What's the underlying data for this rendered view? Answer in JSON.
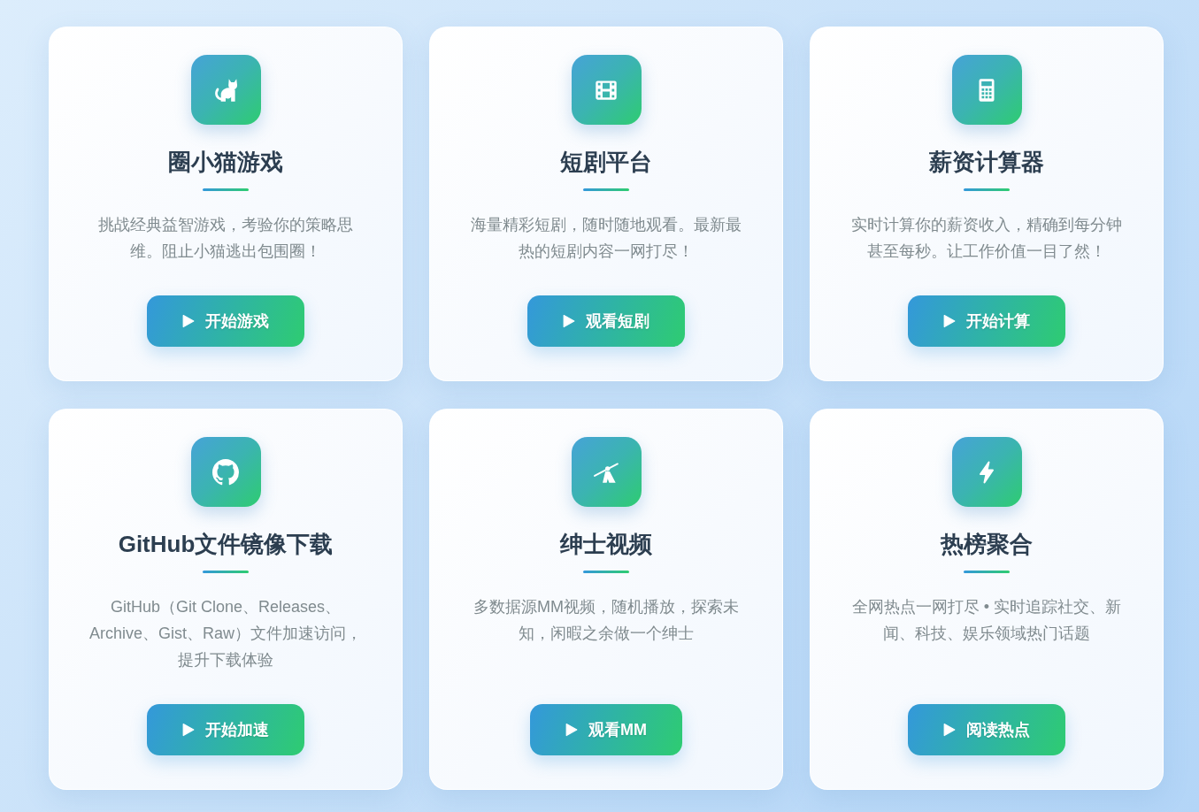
{
  "cards": [
    {
      "kind": "game",
      "title": "圈小猫游戏",
      "description": "挑战经典益智游戏，考验你的策略思维。阻止小猫逃出包围圈！",
      "button": "开始游戏"
    },
    {
      "kind": "drama",
      "title": "短剧平台",
      "description": "海量精彩短剧，随时随地观看。最新最热的短剧内容一网打尽！",
      "button": "观看短剧"
    },
    {
      "kind": "calculator",
      "title": "薪资计算器",
      "description": "实时计算你的薪资收入，精确到每分钟甚至每秒。让工作价值一目了然！",
      "button": "开始计算"
    },
    {
      "kind": "mirror",
      "title": "GitHub文件镜像下载",
      "description": "GitHub（Git Clone、Releases、Archive、Gist、Raw）文件加速访问，提升下载体验",
      "button": "开始加速"
    },
    {
      "kind": "video",
      "title": "绅士视频",
      "description": "多数据源MM视频，随机播放，探索未知，闲暇之余做一个绅士",
      "button": "观看MM"
    },
    {
      "kind": "trending",
      "title": "热榜聚合",
      "description": "全网热点一网打尽 • 实时追踪社交、新闻、科技、娱乐领域热门话题",
      "button": "阅读热点"
    }
  ]
}
